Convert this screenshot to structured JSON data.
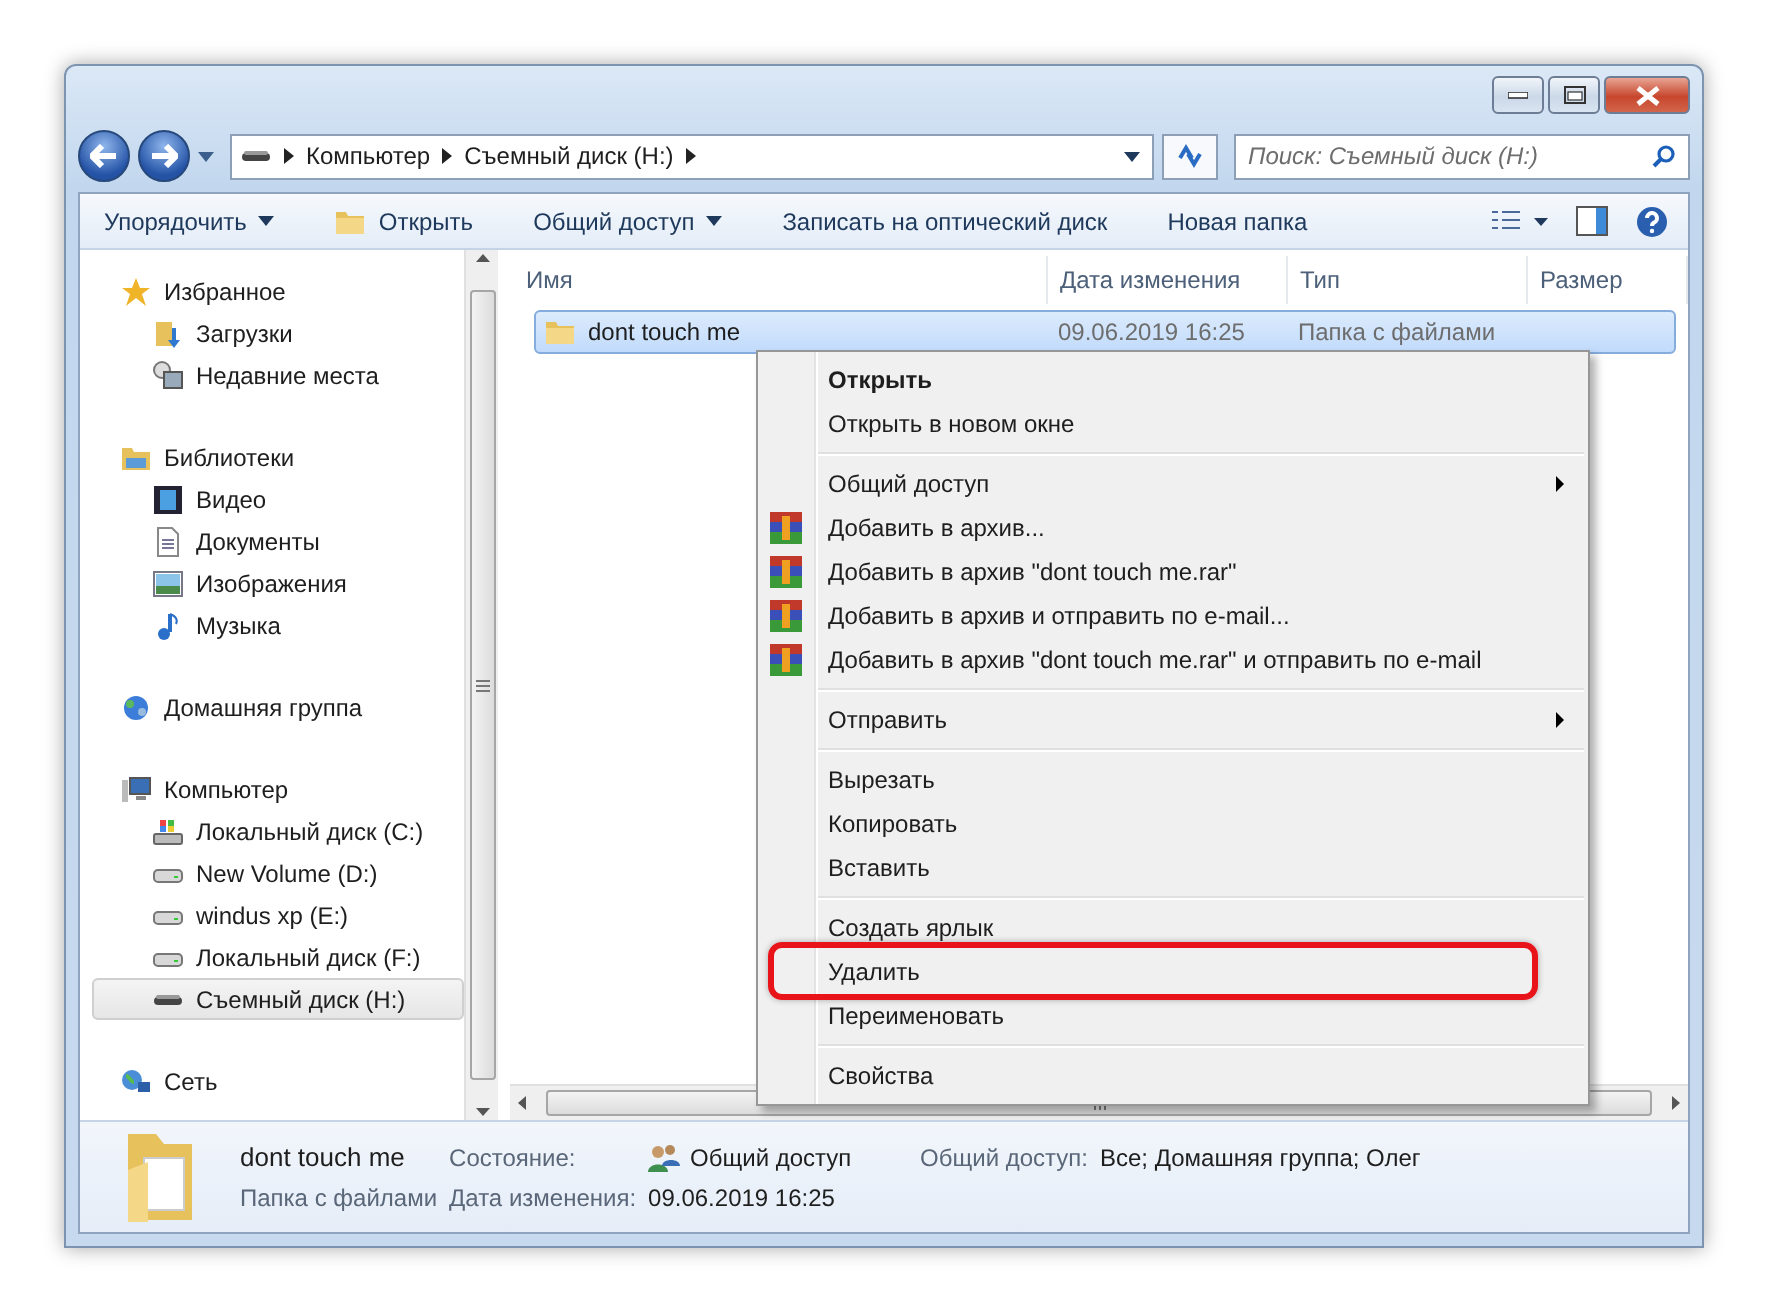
{
  "address": {
    "crumbs": [
      "Компьютер",
      "Съемный диск (H:)"
    ]
  },
  "search": {
    "placeholder": "Поиск: Съемный диск (H:)"
  },
  "toolbar": [
    {
      "label": "Упорядочить",
      "dropdown": true,
      "icon": false
    },
    {
      "label": "Открыть",
      "dropdown": false,
      "icon": true
    },
    {
      "label": "Общий доступ",
      "dropdown": true,
      "icon": false
    },
    {
      "label": "Записать на оптический диск",
      "dropdown": false,
      "icon": false
    },
    {
      "label": "Новая папка",
      "dropdown": false,
      "icon": false
    }
  ],
  "sidebar": {
    "groups": [
      {
        "label": "Избранное",
        "kind": "star",
        "children": [
          {
            "label": "Загрузки",
            "kind": "download",
            "selected": false
          },
          {
            "label": "Недавние места",
            "kind": "recent",
            "selected": false
          }
        ]
      },
      {
        "label": "Библиотеки",
        "kind": "library",
        "children": [
          {
            "label": "Видео",
            "kind": "video",
            "selected": false
          },
          {
            "label": "Документы",
            "kind": "document",
            "selected": false
          },
          {
            "label": "Изображения",
            "kind": "image",
            "selected": false
          },
          {
            "label": "Музыка",
            "kind": "music",
            "selected": false
          }
        ]
      },
      {
        "label": "Домашняя группа",
        "kind": "homegroup"
      },
      {
        "label": "Компьютер",
        "kind": "computer",
        "children": [
          {
            "label": "Локальный диск (C:)",
            "kind": "system",
            "selected": false
          },
          {
            "label": "New Volume (D:)",
            "kind": "drive",
            "selected": false
          },
          {
            "label": "windus xp (E:)",
            "kind": "drive",
            "selected": false
          },
          {
            "label": "Локальный диск (F:)",
            "kind": "drive",
            "selected": false
          },
          {
            "label": "Съемный диск (H:)",
            "kind": "removable",
            "selected": true
          }
        ]
      },
      {
        "label": "Сеть",
        "kind": "network"
      }
    ]
  },
  "table": {
    "columns": [
      "Имя",
      "Дата изменения",
      "Тип",
      "Размер"
    ],
    "rows": [
      {
        "name": "dont touch me",
        "date": "09.06.2019 16:25",
        "type": "Папка с файлами",
        "selected": true
      }
    ]
  },
  "context_menu": [
    {
      "kind": "item",
      "label": "Открыть",
      "bold": true,
      "archive_icon": false,
      "submenu": false,
      "highlighted": false
    },
    {
      "kind": "item",
      "label": "Открыть в новом окне",
      "bold": false,
      "archive_icon": false,
      "submenu": false,
      "highlighted": false
    },
    {
      "kind": "separator"
    },
    {
      "kind": "item",
      "label": "Общий доступ",
      "bold": false,
      "archive_icon": false,
      "submenu": true,
      "highlighted": false
    },
    {
      "kind": "item",
      "label": "Добавить в архив...",
      "bold": false,
      "archive_icon": true,
      "submenu": false,
      "highlighted": false
    },
    {
      "kind": "item",
      "label": "Добавить в архив \"dont touch me.rar\"",
      "bold": false,
      "archive_icon": true,
      "submenu": false,
      "highlighted": false
    },
    {
      "kind": "item",
      "label": "Добавить в архив и отправить по e-mail...",
      "bold": false,
      "archive_icon": true,
      "submenu": false,
      "highlighted": false
    },
    {
      "kind": "item",
      "label": "Добавить в архив \"dont touch me.rar\" и отправить по e-mail",
      "bold": false,
      "archive_icon": true,
      "submenu": false,
      "highlighted": false
    },
    {
      "kind": "separator"
    },
    {
      "kind": "item",
      "label": "Отправить",
      "bold": false,
      "archive_icon": false,
      "submenu": true,
      "highlighted": false
    },
    {
      "kind": "separator"
    },
    {
      "kind": "item",
      "label": "Вырезать",
      "bold": false,
      "archive_icon": false,
      "submenu": false,
      "highlighted": false
    },
    {
      "kind": "item",
      "label": "Копировать",
      "bold": false,
      "archive_icon": false,
      "submenu": false,
      "highlighted": false
    },
    {
      "kind": "item",
      "label": "Вставить",
      "bold": false,
      "archive_icon": false,
      "submenu": false,
      "highlighted": false
    },
    {
      "kind": "separator"
    },
    {
      "kind": "item",
      "label": "Создать ярлык",
      "bold": false,
      "archive_icon": false,
      "submenu": false,
      "highlighted": false
    },
    {
      "kind": "item",
      "label": "Удалить",
      "bold": false,
      "archive_icon": false,
      "submenu": false,
      "highlighted": true
    },
    {
      "kind": "item",
      "label": "Переименовать",
      "bold": false,
      "archive_icon": false,
      "submenu": false,
      "highlighted": false
    },
    {
      "kind": "separator"
    },
    {
      "kind": "item",
      "label": "Свойства",
      "bold": false,
      "archive_icon": false,
      "submenu": false,
      "highlighted": false
    }
  ],
  "details": {
    "name": "dont touch me",
    "type": "Папка с файлами",
    "fields": [
      {
        "label": "Состояние:",
        "value": "Общий доступ",
        "icon": true
      },
      {
        "label": "Общий доступ:",
        "value": "Все; Домашняя группа; Олег",
        "icon": false
      },
      {
        "label": "Дата изменения:",
        "value": "09.06.2019 16:25",
        "icon": false
      }
    ]
  }
}
